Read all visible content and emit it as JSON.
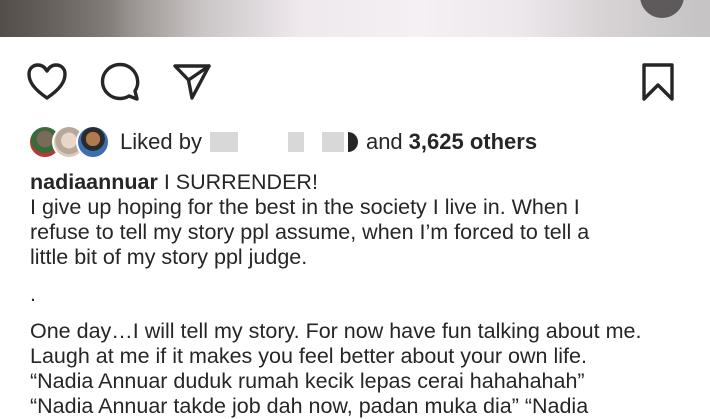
{
  "post": {
    "image_alt": "post-photo-bottom-edge"
  },
  "actions": {
    "like": "heart-icon",
    "comment": "comment-icon",
    "share": "paper-plane-icon",
    "save": "bookmark-icon"
  },
  "likes": {
    "prefix": "Liked by",
    "and_text": "and",
    "count_text": "3,625 others"
  },
  "caption": {
    "username": "nadiaannuar",
    "headline": "I SURRENDER!",
    "lines": [
      "I give up hoping for the best in the society I live in. When I",
      "refuse to tell my story ppl assume, when I’m forced to tell a",
      "little bit of my story ppl judge."
    ],
    "dot": ".",
    "more_lines": [
      "One day…I will tell my story. For now have fun talking about me.",
      "Laugh at me if it makes you feel better about your own life.",
      "“Nadia Annuar duduk rumah kecik lepas cerai hahahahah”",
      "“Nadia Annuar takde job dah now, padan muka dia” “Nadia"
    ]
  },
  "colors": {
    "text": "#262626",
    "redaction": "#d8d8d8"
  }
}
